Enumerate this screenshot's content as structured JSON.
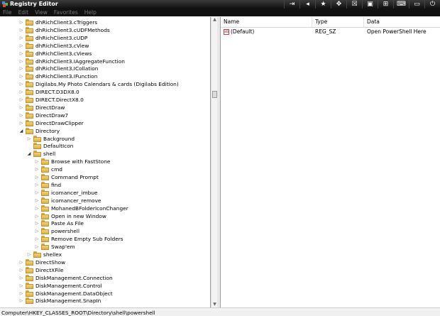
{
  "window": {
    "title": "Registry Editor",
    "toolbar_icons": [
      "pin-icon",
      "back-icon",
      "star-icon",
      "move-icon",
      "close-small-icon",
      "maximize-icon",
      "plus-icon",
      "keyboard-icon",
      "monitor-icon",
      "power-icon"
    ]
  },
  "menu": [
    "File",
    "Edit",
    "View",
    "Favorites",
    "Help"
  ],
  "tree": [
    {
      "label": "dhRichClient3.cTriggers",
      "level": 1,
      "state": "collapsed"
    },
    {
      "label": "dhRichClient3.cUDFMethods",
      "level": 1,
      "state": "collapsed"
    },
    {
      "label": "dhRichClient3.cUDP",
      "level": 1,
      "state": "collapsed"
    },
    {
      "label": "dhRichClient3.cView",
      "level": 1,
      "state": "collapsed"
    },
    {
      "label": "dhRichClient3.cViews",
      "level": 1,
      "state": "collapsed"
    },
    {
      "label": "dhRichClient3.IAggregateFunction",
      "level": 1,
      "state": "collapsed"
    },
    {
      "label": "dhRichClient3.ICollation",
      "level": 1,
      "state": "collapsed"
    },
    {
      "label": "dhRichClient3.IFunction",
      "level": 1,
      "state": "collapsed"
    },
    {
      "label": "Digilabs.My Photo Calendars & cards (Digilabs Edition)",
      "level": 1,
      "state": "collapsed"
    },
    {
      "label": "DIRECT.D3DX8.0",
      "level": 1,
      "state": "collapsed"
    },
    {
      "label": "DIRECT.DirectX8.0",
      "level": 1,
      "state": "collapsed"
    },
    {
      "label": "DirectDraw",
      "level": 1,
      "state": "collapsed"
    },
    {
      "label": "DirectDraw7",
      "level": 1,
      "state": "collapsed"
    },
    {
      "label": "DirectDrawClipper",
      "level": 1,
      "state": "collapsed"
    },
    {
      "label": "Directory",
      "level": 1,
      "state": "expanded"
    },
    {
      "label": "Background",
      "level": 2,
      "state": "collapsed"
    },
    {
      "label": "DefaultIcon",
      "level": 2,
      "state": "none"
    },
    {
      "label": "shell",
      "level": 2,
      "state": "expanded"
    },
    {
      "label": "Browse with FastStone",
      "level": 3,
      "state": "collapsed"
    },
    {
      "label": "cmd",
      "level": 3,
      "state": "collapsed"
    },
    {
      "label": "Command Prompt",
      "level": 3,
      "state": "collapsed"
    },
    {
      "label": "find",
      "level": 3,
      "state": "collapsed"
    },
    {
      "label": "icomancer_imbue",
      "level": 3,
      "state": "collapsed"
    },
    {
      "label": "icomancer_remove",
      "level": 3,
      "state": "collapsed"
    },
    {
      "label": "MohanedBFolderIconChanger",
      "level": 3,
      "state": "collapsed"
    },
    {
      "label": "Open in new Window",
      "level": 3,
      "state": "collapsed"
    },
    {
      "label": "Paste As File",
      "level": 3,
      "state": "collapsed"
    },
    {
      "label": "powershell",
      "level": 3,
      "state": "collapsed"
    },
    {
      "label": "Remove Empty Sub Folders",
      "level": 3,
      "state": "collapsed"
    },
    {
      "label": "Swap'em",
      "level": 3,
      "state": "collapsed"
    },
    {
      "label": "shellex",
      "level": 2,
      "state": "collapsed"
    },
    {
      "label": "DirectShow",
      "level": 1,
      "state": "collapsed"
    },
    {
      "label": "DirectXFile",
      "level": 1,
      "state": "collapsed"
    },
    {
      "label": "DiskManagement.Connection",
      "level": 1,
      "state": "collapsed"
    },
    {
      "label": "DiskManagement.Control",
      "level": 1,
      "state": "collapsed"
    },
    {
      "label": "DiskManagement.DataObject",
      "level": 1,
      "state": "collapsed"
    },
    {
      "label": "DiskManagement.SnapIn",
      "level": 1,
      "state": "collapsed"
    }
  ],
  "values_pane": {
    "columns": [
      "Name",
      "Type",
      "Data"
    ],
    "rows": [
      {
        "name": "(Default)",
        "type": "REG_SZ",
        "data": "Open PowerShell Here"
      }
    ]
  },
  "status": "Computer\\HKEY_CLASSES_ROOT\\Directory\\shell\\powershell"
}
